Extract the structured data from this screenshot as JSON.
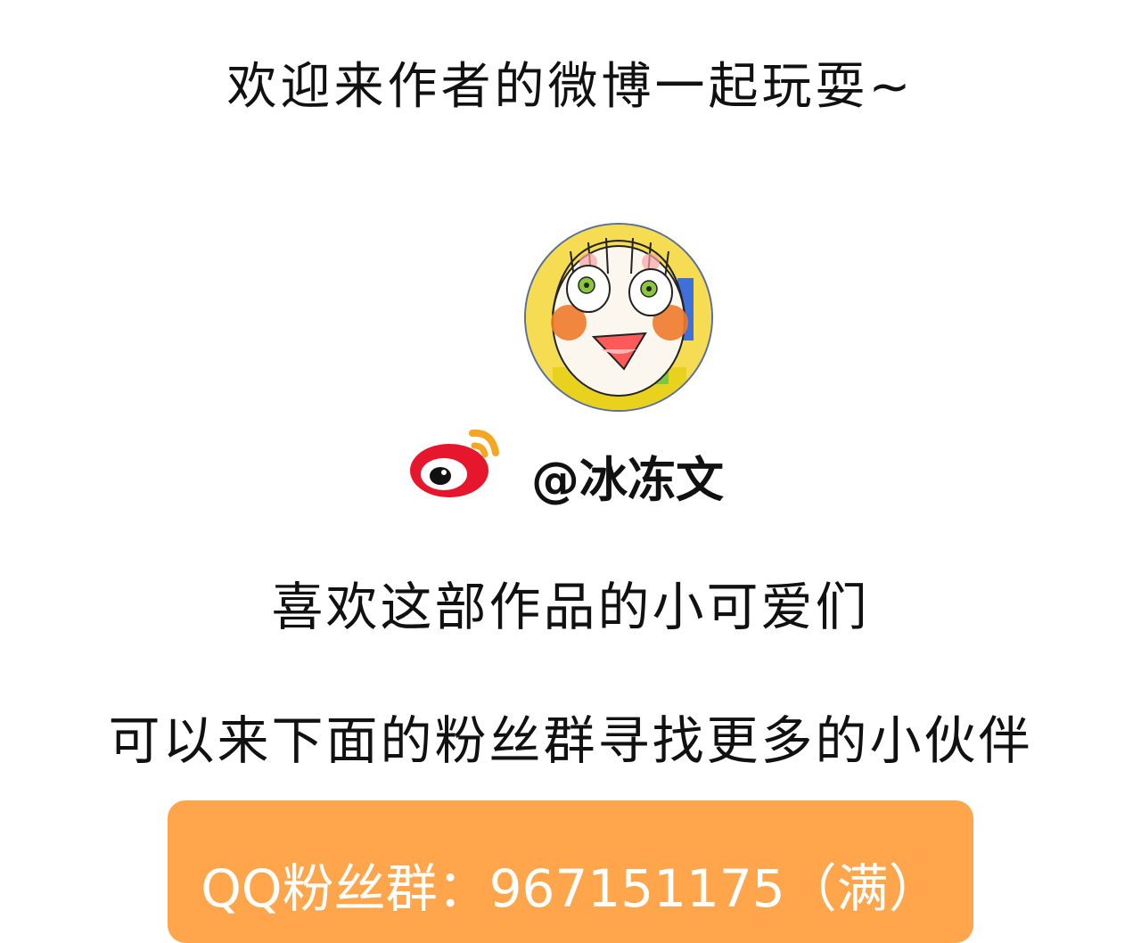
{
  "title": "欢迎来作者的微博一起玩耍~",
  "avatar": {
    "icon": "avatar-cartoon-girl"
  },
  "weibo": {
    "icon": "weibo-logo-icon",
    "handle": "@冰冻文"
  },
  "lines": [
    "喜欢这部作品的小可爱们",
    "可以来下面的粉丝群寻找更多的小伙伴"
  ],
  "qq_group": {
    "text": "QQ粉丝群：967151175（满）"
  },
  "colors": {
    "qq_box": "#ffa64d",
    "weibo_red": "#e6162d",
    "weibo_orange": "#f5a623"
  }
}
